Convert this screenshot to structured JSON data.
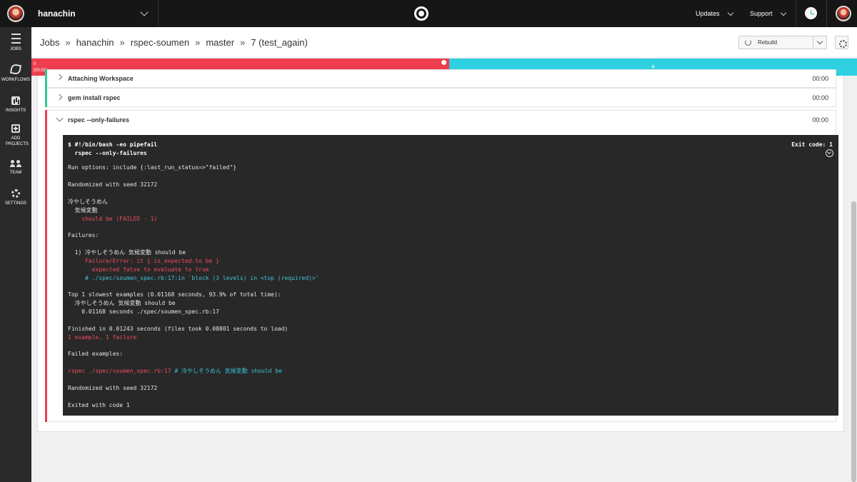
{
  "org": {
    "name": "hanachin"
  },
  "topnav": {
    "updates": "Updates",
    "support": "Support"
  },
  "sidebar": {
    "items": [
      {
        "label": "JOBS"
      },
      {
        "label": "WORKFLOWS"
      },
      {
        "label": "INSIGHTS"
      },
      {
        "label": "ADD PROJECTS"
      },
      {
        "label": "TEAM"
      },
      {
        "label": "SETTINGS"
      }
    ]
  },
  "breadcrumb": {
    "separator": "»",
    "items": [
      "Jobs",
      "hanachin",
      "rspec-soumen",
      "master",
      "7 (test_again)"
    ]
  },
  "toolbar": {
    "rebuild_label": "Rebuild"
  },
  "parallel": {
    "runs": [
      {
        "index": "0",
        "duration": "(00:05)",
        "color": "#ed3d4e"
      }
    ],
    "add_label": "+",
    "add_color": "#2ed0e2"
  },
  "steps": [
    {
      "name": "Attaching Workspace",
      "time": "00:00",
      "status_color": "#2ecc8e"
    },
    {
      "name": "gem install rspec",
      "time": "00:00",
      "status_color": "#2ecc8e"
    },
    {
      "name": "rspec --only-failures",
      "time": "00:00",
      "status_color": "#ed3d4e"
    }
  ],
  "terminal": {
    "command": "$ #!/bin/bash -eo pipefail",
    "command2": "  rspec --only-failures",
    "exit_code": "Exit code: 1",
    "lines": [
      {
        "text": "Run options: include {:last_run_status=>\"failed\"}",
        "color": "normal"
      },
      {
        "text": "Randomized with seed 32172",
        "color": "normal"
      },
      {
        "text": "冷やしそうめん",
        "color": "normal"
      },
      {
        "text": "  気候変動",
        "color": "normal"
      },
      {
        "text": "    should be (FAILED - 1)",
        "color": "red"
      },
      {
        "text": "Failures:",
        "color": "normal"
      },
      {
        "text": "  1) 冷やしそうめん 気候変動 should be",
        "color": "normal"
      },
      {
        "text": "     Failure/Error: it { is_expected.to be }",
        "color": "red"
      },
      {
        "text": "       expected false to evaluate to true",
        "color": "red"
      },
      {
        "text": "     # ./spec/soumen_spec.rb:17:in `block (3 levels) in <top (required)>'",
        "color": "cyan"
      },
      {
        "text": "Top 1 slowest examples (0.01168 seconds, 93.9% of total time):",
        "color": "normal"
      },
      {
        "text": "  冷やしそうめん 気候変動 should be",
        "color": "normal"
      },
      {
        "text": "    0.01168 seconds ./spec/soumen_spec.rb:17",
        "color": "normal"
      },
      {
        "text": "Finished in 0.01243 seconds (files took 0.08801 seconds to load)",
        "color": "normal"
      },
      {
        "text": "1 example, 1 failure",
        "color": "red"
      },
      {
        "text": "Failed examples:",
        "color": "normal"
      },
      {
        "text_red": "rspec ./spec/soumen_spec.rb:17",
        "text_cyan": " # 冷やしそうめん 気候変動 should be",
        "color": "mixed"
      },
      {
        "text": "Randomized with seed 32172",
        "color": "normal"
      },
      {
        "text": "Exited with code 1",
        "color": "normal"
      }
    ]
  }
}
